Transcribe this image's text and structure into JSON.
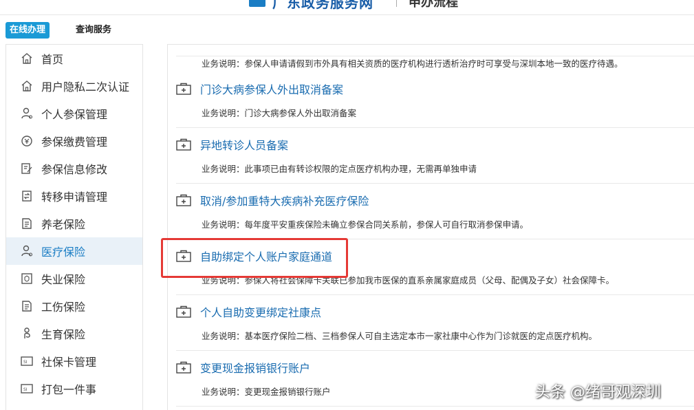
{
  "header": {
    "title": "广东政务服务网",
    "subtitle": "申办流程"
  },
  "tabs": [
    {
      "label": "在线办理",
      "active": true
    },
    {
      "label": "查询服务",
      "active": false
    }
  ],
  "sidebar": {
    "items": [
      {
        "label": "首页",
        "icon": "home-icon"
      },
      {
        "label": "用户隐私二次认证",
        "icon": "home-icon"
      },
      {
        "label": "个人参保管理",
        "icon": "person-icon"
      },
      {
        "label": "参保缴费管理",
        "icon": "payment-icon"
      },
      {
        "label": "参保信息修改",
        "icon": "edit-icon"
      },
      {
        "label": "转移申请管理",
        "icon": "transfer-icon"
      },
      {
        "label": "养老保险",
        "icon": "document-icon"
      },
      {
        "label": "医疗保险",
        "icon": "person-icon",
        "active": true
      },
      {
        "label": "失业保险",
        "icon": "shield-doc-icon"
      },
      {
        "label": "工伤保险",
        "icon": "document-icon"
      },
      {
        "label": "生育保险",
        "icon": "maternity-icon"
      },
      {
        "label": "社保卡管理",
        "icon": "card-icon"
      },
      {
        "label": "打包一件事",
        "icon": "card-icon"
      }
    ]
  },
  "services": {
    "prefix": "业务说明：",
    "first_desc": "参保人申请请假到市外具有相关资质的医疗机构进行透析治疗时可享受与深圳本地一致的医疗待遇。",
    "items": [
      {
        "title": "门诊大病参保人外出取消备案",
        "desc": "门诊大病参保人外出取消备案"
      },
      {
        "title": "异地转诊人员备案",
        "desc": "此事项已由有转诊权限的定点医疗机构办理，无需再单独申请"
      },
      {
        "title": "取消/参加重特大疾病补充医疗保险",
        "desc": "每年度平安重疾保险未确立参保合同关系前，参保人可自行取消参保申请。"
      },
      {
        "title": "自助绑定个人账户家庭通道",
        "desc": "参保人将社会保障卡关联已参加我市医保的直系亲属家庭成员（父母、配偶及子女）社会保障卡。"
      },
      {
        "title": "个人自助变更绑定社康点",
        "desc": "基本医疗保险二档、三档参保人可自主选定本市一家社康中心作为门诊就医的定点医疗机构。"
      },
      {
        "title": "变更现金报销银行账户",
        "desc": "变更现金报销银行账户"
      }
    ]
  },
  "watermark": "头条 @绪哥观深圳",
  "colors": {
    "accent": "#1a9ad6",
    "link": "#1a6cb0",
    "highlight": "#e53935",
    "active_bg": "#e9f1f8"
  }
}
